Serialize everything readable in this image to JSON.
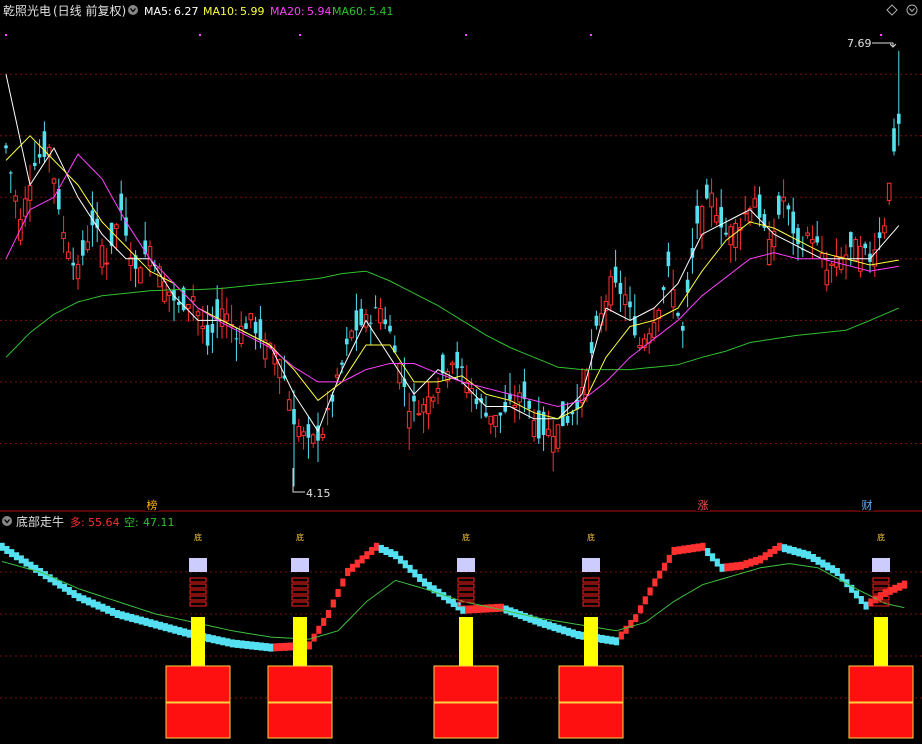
{
  "colors": {
    "bg": "#000000",
    "grid": "#7a1010",
    "divider": "#b01010",
    "up": "#ff3030",
    "down": "#54e0f0",
    "ma5": "#ffffff",
    "ma10": "#ffff40",
    "ma20": "#ff40ff",
    "ma60": "#30c030",
    "title": "#e0e0e0",
    "many": "#ff3030",
    "empty": "#30c030",
    "bottom_box": "#ff1010",
    "bottom_box_border": "#ffd040",
    "yellow_bar": "#ffff00",
    "lavender": "#ccccff",
    "lower_line": "#40c040"
  },
  "top_panel": {
    "stock_name": "乾照光电",
    "period": "(日线 前复权)",
    "ma5_label": "MA5:",
    "ma5_value": "6.27",
    "ma10_label": "MA10:",
    "ma10_value": "5.99",
    "ma20_label": "MA20:",
    "ma20_value": "5.94",
    "ma60_label": "MA60:",
    "ma60_value": "5.41",
    "max_label": "7.69",
    "min_label": "4.15"
  },
  "markers": [
    {
      "text": "榜",
      "x": 152,
      "color": "#ffb000"
    },
    {
      "text": "涨",
      "x": 703,
      "color": "#ff5050"
    },
    {
      "text": "财",
      "x": 867,
      "color": "#60b0ff"
    }
  ],
  "bottom_panel": {
    "title": "底部走牛",
    "many_label": "多:",
    "many_value": "55.64",
    "empty_label": "空:",
    "empty_value": "47.11",
    "signal_text": "底"
  },
  "chart_data": [
    {
      "type": "candlestick",
      "title": "",
      "ylim": [
        4.0,
        7.9
      ],
      "max_price": 7.69,
      "min_price": 4.15,
      "anchors_close": [
        [
          0,
          6.9
        ],
        [
          3,
          6.3
        ],
        [
          6,
          6.8
        ],
        [
          9,
          6.9
        ],
        [
          12,
          6.2
        ],
        [
          15,
          5.9
        ],
        [
          18,
          6.3
        ],
        [
          21,
          6.0
        ],
        [
          24,
          6.4
        ],
        [
          27,
          5.9
        ],
        [
          30,
          6.1
        ],
        [
          33,
          5.8
        ],
        [
          36,
          5.6
        ],
        [
          39,
          5.7
        ],
        [
          42,
          5.3
        ],
        [
          45,
          5.6
        ],
        [
          48,
          5.4
        ],
        [
          51,
          5.5
        ],
        [
          54,
          5.3
        ],
        [
          57,
          5.2
        ],
        [
          60,
          4.7
        ],
        [
          63,
          4.5
        ],
        [
          66,
          4.6
        ],
        [
          69,
          5.0
        ],
        [
          72,
          5.4
        ],
        [
          75,
          5.5
        ],
        [
          78,
          5.6
        ],
        [
          81,
          5.3
        ],
        [
          84,
          4.8
        ],
        [
          87,
          4.8
        ],
        [
          90,
          5.0
        ],
        [
          93,
          5.2
        ],
        [
          96,
          5.0
        ],
        [
          99,
          4.8
        ],
        [
          102,
          4.7
        ],
        [
          105,
          4.8
        ],
        [
          108,
          4.9
        ],
        [
          111,
          4.6
        ],
        [
          114,
          4.6
        ],
        [
          117,
          4.7
        ],
        [
          120,
          4.9
        ],
        [
          123,
          5.4
        ],
        [
          126,
          5.8
        ],
        [
          129,
          5.7
        ],
        [
          132,
          5.3
        ],
        [
          135,
          5.5
        ],
        [
          138,
          5.9
        ],
        [
          141,
          5.4
        ],
        [
          144,
          6.3
        ],
        [
          147,
          6.5
        ],
        [
          150,
          6.2
        ],
        [
          153,
          6.3
        ],
        [
          156,
          6.5
        ],
        [
          159,
          6.1
        ],
        [
          162,
          6.5
        ],
        [
          165,
          6.1
        ],
        [
          168,
          6.2
        ],
        [
          171,
          5.9
        ],
        [
          174,
          6.0
        ],
        [
          177,
          6.1
        ],
        [
          180,
          6.0
        ],
        [
          183,
          6.3
        ],
        [
          185,
          6.9
        ],
        [
          186,
          7.1
        ]
      ],
      "ma_anchors": {
        "MA5": [
          [
            0,
            7.5
          ],
          [
            5,
            6.6
          ],
          [
            10,
            6.9
          ],
          [
            15,
            6.5
          ],
          [
            20,
            6.2
          ],
          [
            25,
            6.0
          ],
          [
            30,
            6.0
          ],
          [
            35,
            5.7
          ],
          [
            40,
            5.5
          ],
          [
            45,
            5.5
          ],
          [
            50,
            5.4
          ],
          [
            55,
            5.3
          ],
          [
            60,
            4.9
          ],
          [
            65,
            4.6
          ],
          [
            70,
            5.1
          ],
          [
            75,
            5.5
          ],
          [
            80,
            5.2
          ],
          [
            85,
            4.9
          ],
          [
            90,
            5.1
          ],
          [
            95,
            5.0
          ],
          [
            100,
            4.8
          ],
          [
            105,
            4.8
          ],
          [
            110,
            4.7
          ],
          [
            115,
            4.7
          ],
          [
            120,
            4.9
          ],
          [
            125,
            5.6
          ],
          [
            130,
            5.5
          ],
          [
            135,
            5.6
          ],
          [
            140,
            5.8
          ],
          [
            145,
            6.2
          ],
          [
            150,
            6.3
          ],
          [
            155,
            6.4
          ],
          [
            160,
            6.2
          ],
          [
            165,
            6.1
          ],
          [
            170,
            6.0
          ],
          [
            175,
            6.0
          ],
          [
            180,
            6.0
          ],
          [
            186,
            6.27
          ]
        ],
        "MA10": [
          [
            0,
            6.8
          ],
          [
            5,
            7.0
          ],
          [
            10,
            6.8
          ],
          [
            15,
            6.6
          ],
          [
            20,
            6.3
          ],
          [
            25,
            6.1
          ],
          [
            30,
            5.9
          ],
          [
            35,
            5.8
          ],
          [
            40,
            5.6
          ],
          [
            45,
            5.5
          ],
          [
            50,
            5.4
          ],
          [
            55,
            5.3
          ],
          [
            60,
            5.1
          ],
          [
            65,
            4.85
          ],
          [
            70,
            5.0
          ],
          [
            75,
            5.3
          ],
          [
            80,
            5.3
          ],
          [
            85,
            5.0
          ],
          [
            90,
            5.0
          ],
          [
            95,
            5.05
          ],
          [
            100,
            4.9
          ],
          [
            105,
            4.85
          ],
          [
            110,
            4.75
          ],
          [
            115,
            4.7
          ],
          [
            120,
            4.8
          ],
          [
            125,
            5.2
          ],
          [
            130,
            5.45
          ],
          [
            135,
            5.5
          ],
          [
            140,
            5.6
          ],
          [
            145,
            5.9
          ],
          [
            150,
            6.15
          ],
          [
            155,
            6.3
          ],
          [
            160,
            6.25
          ],
          [
            165,
            6.15
          ],
          [
            170,
            6.05
          ],
          [
            175,
            6.0
          ],
          [
            180,
            5.95
          ],
          [
            186,
            5.99
          ]
        ],
        "MA20": [
          [
            0,
            6.0
          ],
          [
            5,
            6.4
          ],
          [
            10,
            6.5
          ],
          [
            15,
            6.85
          ],
          [
            20,
            6.65
          ],
          [
            25,
            6.3
          ],
          [
            30,
            6.0
          ],
          [
            35,
            5.8
          ],
          [
            40,
            5.6
          ],
          [
            45,
            5.48
          ],
          [
            50,
            5.38
          ],
          [
            55,
            5.28
          ],
          [
            60,
            5.12
          ],
          [
            65,
            5.0
          ],
          [
            70,
            5.0
          ],
          [
            75,
            5.1
          ],
          [
            80,
            5.15
          ],
          [
            85,
            5.15
          ],
          [
            90,
            5.07
          ],
          [
            95,
            5.0
          ],
          [
            100,
            4.95
          ],
          [
            105,
            4.9
          ],
          [
            110,
            4.85
          ],
          [
            115,
            4.8
          ],
          [
            120,
            4.85
          ],
          [
            125,
            5.0
          ],
          [
            130,
            5.2
          ],
          [
            135,
            5.35
          ],
          [
            140,
            5.5
          ],
          [
            145,
            5.7
          ],
          [
            150,
            5.85
          ],
          [
            155,
            6.0
          ],
          [
            160,
            6.05
          ],
          [
            165,
            6.0
          ],
          [
            170,
            6.0
          ],
          [
            175,
            5.95
          ],
          [
            180,
            5.9
          ],
          [
            186,
            5.94
          ]
        ],
        "MA60": [
          [
            0,
            5.2
          ],
          [
            5,
            5.4
          ],
          [
            10,
            5.55
          ],
          [
            15,
            5.65
          ],
          [
            20,
            5.7
          ],
          [
            25,
            5.72
          ],
          [
            30,
            5.74
          ],
          [
            35,
            5.75
          ],
          [
            40,
            5.75
          ],
          [
            45,
            5.76
          ],
          [
            50,
            5.78
          ],
          [
            55,
            5.8
          ],
          [
            60,
            5.82
          ],
          [
            65,
            5.84
          ],
          [
            70,
            5.88
          ],
          [
            75,
            5.9
          ],
          [
            80,
            5.82
          ],
          [
            85,
            5.72
          ],
          [
            90,
            5.62
          ],
          [
            95,
            5.5
          ],
          [
            100,
            5.38
          ],
          [
            105,
            5.28
          ],
          [
            110,
            5.2
          ],
          [
            115,
            5.12
          ],
          [
            120,
            5.1
          ],
          [
            125,
            5.1
          ],
          [
            130,
            5.1
          ],
          [
            135,
            5.12
          ],
          [
            140,
            5.14
          ],
          [
            145,
            5.2
          ],
          [
            150,
            5.25
          ],
          [
            155,
            5.32
          ],
          [
            160,
            5.35
          ],
          [
            165,
            5.38
          ],
          [
            170,
            5.4
          ],
          [
            175,
            5.42
          ],
          [
            180,
            5.5
          ],
          [
            186,
            5.6
          ]
        ]
      }
    },
    {
      "type": "indicator",
      "title": "",
      "ylim": [
        0,
        100
      ],
      "many_anchors": [
        [
          0,
          92
        ],
        [
          8,
          80
        ],
        [
          16,
          68
        ],
        [
          24,
          60
        ],
        [
          32,
          55
        ],
        [
          40,
          50
        ],
        [
          48,
          46
        ],
        [
          56,
          44
        ],
        [
          64,
          45
        ],
        [
          68,
          60
        ],
        [
          72,
          80
        ],
        [
          78,
          92
        ],
        [
          82,
          88
        ],
        [
          88,
          75
        ],
        [
          96,
          62
        ],
        [
          104,
          63
        ],
        [
          112,
          56
        ],
        [
          120,
          50
        ],
        [
          128,
          47
        ],
        [
          132,
          58
        ],
        [
          136,
          75
        ],
        [
          140,
          90
        ],
        [
          146,
          92
        ],
        [
          150,
          82
        ],
        [
          154,
          83
        ],
        [
          158,
          86
        ],
        [
          162,
          92
        ],
        [
          168,
          88
        ],
        [
          174,
          80
        ],
        [
          180,
          64
        ],
        [
          184,
          70
        ],
        [
          188,
          74
        ]
      ],
      "empty_anchors": [
        [
          0,
          85
        ],
        [
          8,
          80
        ],
        [
          16,
          72
        ],
        [
          24,
          66
        ],
        [
          32,
          60
        ],
        [
          40,
          56
        ],
        [
          48,
          52
        ],
        [
          56,
          49
        ],
        [
          64,
          48
        ],
        [
          70,
          52
        ],
        [
          76,
          66
        ],
        [
          82,
          76
        ],
        [
          88,
          72
        ],
        [
          96,
          66
        ],
        [
          104,
          62
        ],
        [
          112,
          58
        ],
        [
          120,
          55
        ],
        [
          128,
          52
        ],
        [
          134,
          56
        ],
        [
          140,
          66
        ],
        [
          146,
          74
        ],
        [
          152,
          78
        ],
        [
          158,
          82
        ],
        [
          164,
          84
        ],
        [
          170,
          82
        ],
        [
          178,
          72
        ],
        [
          184,
          65
        ],
        [
          188,
          63
        ]
      ],
      "signals": [
        {
          "x": 198,
          "yellow_to": 63.2,
          "lavender": true
        },
        {
          "x": 300,
          "yellow_to": 63.2,
          "lavender": true
        },
        {
          "x": 466,
          "yellow_to": 63.2,
          "lavender": true
        },
        {
          "x": 591,
          "yellow_to": 63.2,
          "lavender": true
        },
        {
          "x": 881,
          "yellow_to": 63.2,
          "lavender": true
        }
      ]
    }
  ]
}
